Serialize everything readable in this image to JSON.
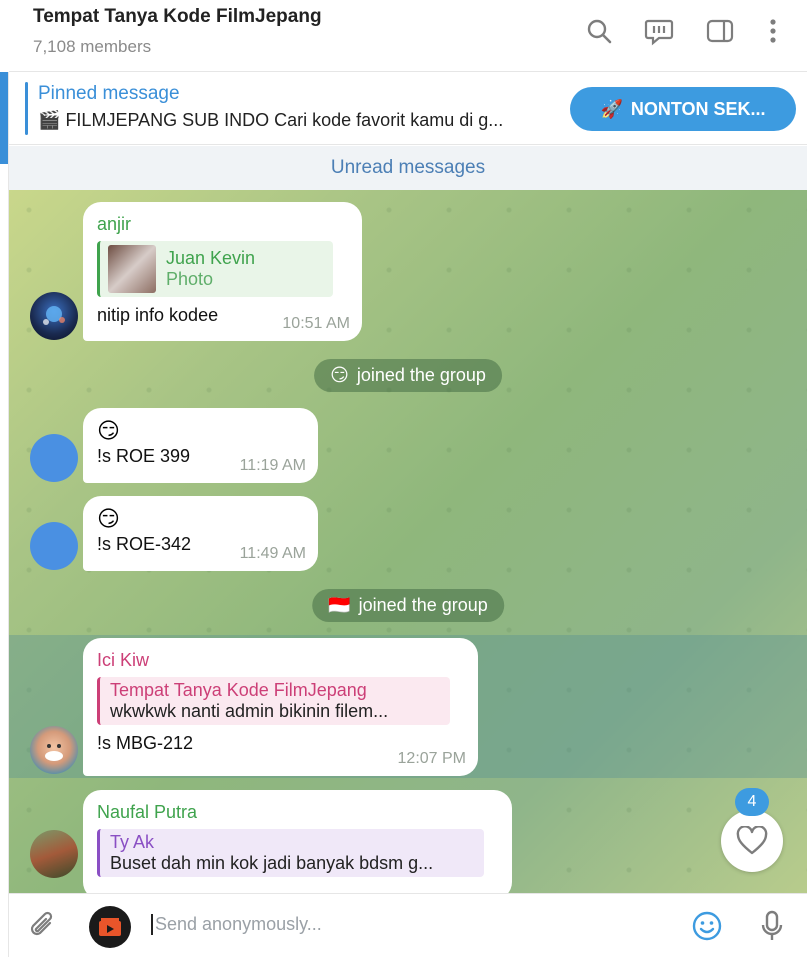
{
  "header": {
    "title": "Tempat Tanya Kode FilmJepang",
    "members": "7,108 members",
    "icons": [
      "search-icon",
      "topics-icon",
      "sidebar-toggle-icon",
      "more-icon"
    ]
  },
  "pinned": {
    "title": "Pinned message",
    "emoji": "🎬",
    "text": "FILMJEPANG SUB INDO  Cari kode favorit kamu di g...",
    "button_emoji": "🚀",
    "button_label": "NONTON SEK..."
  },
  "unread_label": "Unread messages",
  "messages": [
    {
      "sender": "anjir",
      "sender_color": "#3fa34d",
      "reply_name": "Juan Kevin",
      "reply_text": "Photo",
      "text": "nitip info kodee",
      "time": "10:51 AM"
    },
    {
      "service_emoji": "😏",
      "service_text": "joined the group"
    },
    {
      "emoji": "😏",
      "text": "!s ROE 399",
      "time": "11:19 AM"
    },
    {
      "emoji": "😏",
      "text": "!s ROE-342",
      "time": "11:49 AM"
    },
    {
      "service_emoji": "🇮🇩",
      "service_text": "joined the group"
    },
    {
      "sender": "Ici Kiw",
      "sender_color": "#cc3f77",
      "reply_name": "Tempat Tanya Kode FilmJepang",
      "reply_text": "wkwkwk nanti admin bikinin filem...",
      "text": "!s MBG-212",
      "time": "12:07 PM"
    },
    {
      "sender": "Naufal Putra",
      "sender_color": "#3fa34d",
      "reply_name": "Ty Ak",
      "reply_text": "Buset dah min kok jadi banyak bdsm g..."
    }
  ],
  "reaction": {
    "count": "4",
    "icon": "heart-icon"
  },
  "composer": {
    "placeholder": "Send anonymously..."
  },
  "colors": {
    "accent": "#3a8fd8",
    "button": "#3d9be0",
    "green_name": "#3fa34d",
    "pink_name": "#cc3f77",
    "purple_name": "#8a4fc4"
  }
}
